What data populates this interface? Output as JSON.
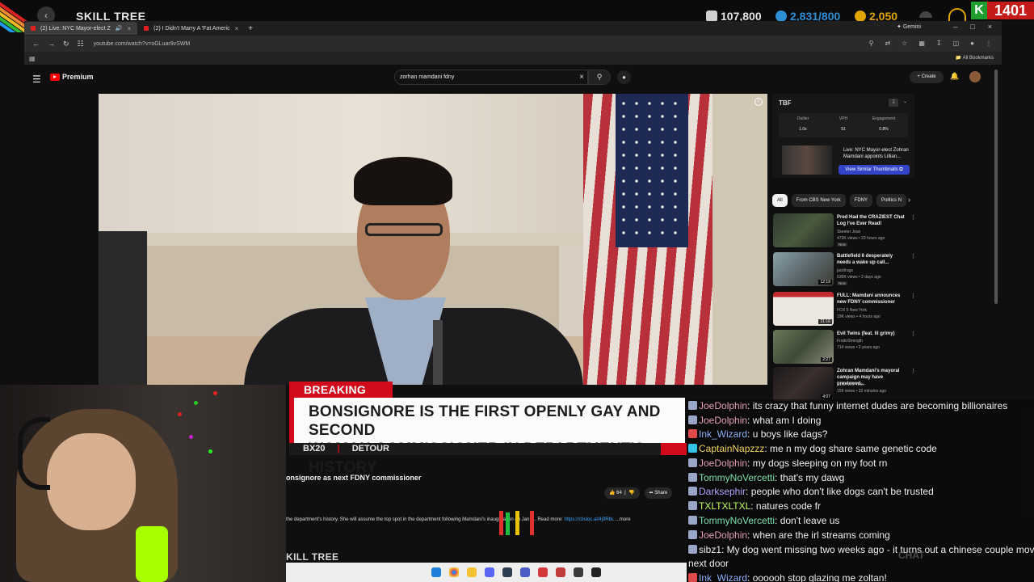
{
  "overlay": {
    "title": "SKILL TREE",
    "stats": [
      {
        "value": "107,800",
        "color": "#e6e6e6",
        "icon": "fist-icon"
      },
      {
        "value": "2,831/800",
        "color": "#2f8fd6",
        "icon": "shield-icon"
      },
      {
        "value": "2,050",
        "color": "#e0a400",
        "icon": "coin-icon"
      }
    ],
    "k_badge": "K",
    "counter": "1401"
  },
  "browser": {
    "tabs": [
      {
        "label": "(2) Live: NYC Mayor-elect Z"
      },
      {
        "label": "(2) I Didn't Marry A 'Fat Americ"
      }
    ],
    "gemini": "Gemini",
    "url": "youtube.com/watch?v=oGLuar9vSWM",
    "all_bookmarks": "All Bookmarks"
  },
  "youtube": {
    "premium_label": "Premium",
    "search_value": "zorhan mamdani fdny",
    "create_label": "Create",
    "video": {
      "breaking_tag": "BREAKING NEWS",
      "headline_line1": "BONSIGNORE IS THE FIRST OPENLY GAY AND SECOND",
      "headline_line2": "WOMAN COMMISSIONER IN DEPARTMENT'S HISTORY",
      "sub_left": "BX20",
      "sub_right": "DETOUR"
    },
    "title_fragment": "onsignore as next FDNY commissioner",
    "like_count": "64",
    "share_label": "Share",
    "desc_text": "the department's history. She will assume the top spot in the department following Mamdani's inauguration on Jan. 1. Read more:",
    "desc_link": "https://cbsloc.al/4j9RbL",
    "desc_more": "...more",
    "bottom_brand": "KILL TREE"
  },
  "extension": {
    "logo": "TBF",
    "stats": [
      {
        "label": "Outlier",
        "value": "1.0x"
      },
      {
        "label": "VPH",
        "value": "51"
      },
      {
        "label": "Engagement",
        "value": "0.8%"
      }
    ],
    "current_title": "Live: NYC Mayor-elect Zohran Mamdani appoints Lillian...",
    "similar_button": "View Similar Thumbnails"
  },
  "chips": [
    "All",
    "From CBS New York",
    "FDNY",
    "Politics N"
  ],
  "recommendations": [
    {
      "title": "Pred Had the CRAZIEST Chat Log I've Ever Read!",
      "channel": "Skeeter Jean",
      "meta": "473K views • 23 hours ago",
      "badge": "New",
      "duration": "",
      "thumb": "#3a4a3e"
    },
    {
      "title": "Battlefield 6 desperately needs a wake up call...",
      "channel": "jackfrags",
      "meta": "636K views • 2 days ago",
      "badge": "New",
      "duration": "12:19",
      "thumb": "#5d6a6f"
    },
    {
      "title": "FULL: Mamdani announces new FDNY commissioner",
      "channel": "FOX 5 New York",
      "meta": "19K views • 4 hours ago",
      "badge": "",
      "duration": "21:16",
      "thumb": "#6b2a2e"
    },
    {
      "title": "Evil Twins (feat. lil grimy)",
      "channel": "FredoStrength",
      "meta": "714 views • 2 years ago",
      "badge": "",
      "duration": "2:27",
      "thumb": "#4a5a3e"
    },
    {
      "title": "Zohran Mamdani's mayoral campaign may have previewed...",
      "channel": "CBS New York",
      "meta": "159 views • 33 minutes ago",
      "badge": "New",
      "duration": "4:07",
      "thumb": "#2e2a2a"
    }
  ],
  "chat": [
    {
      "user": "JoeDolphin",
      "color": "#e8a0b8",
      "text": ": its crazy that funny internet dudes are becoming billionaires",
      "badge": "#9aa6c8"
    },
    {
      "user": "JoeDolphin",
      "color": "#e8a0b8",
      "text": ": what am I doing",
      "badge": "#9aa6c8"
    },
    {
      "user": "Ink_Wizard",
      "color": "#8fb3ff",
      "text": ": u boys like dags?",
      "badge": "#e04a4a"
    },
    {
      "user": "CaptainNapzzz",
      "color": "#f4d35e",
      "text": ": me n my dog share same genetic code",
      "badge": "#34c3e8"
    },
    {
      "user": "JoeDolphin",
      "color": "#e8a0b8",
      "text": ": my dogs sleeping on my foot rn",
      "badge": "#9aa6c8"
    },
    {
      "user": "TommyNoVercetti",
      "color": "#7fe3b0",
      "text": ": that's my dawg",
      "badge": "#9aa6c8"
    },
    {
      "user": "Darksephir",
      "color": "#b9a4ff",
      "text": ": people who don't like dogs can't be trusted",
      "badge": "#9aa6c8"
    },
    {
      "user": "TXLTXLTXL",
      "color": "#c3ff5c",
      "text": ": natures code fr",
      "badge": "#9aa6c8"
    },
    {
      "user": "TommyNoVercetti",
      "color": "#7fe3b0",
      "text": ": don't leave us",
      "badge": "#9aa6c8"
    },
    {
      "user": "JoeDolphin",
      "color": "#e8a0b8",
      "text": ": when are the irl streams coming",
      "badge": "#9aa6c8"
    },
    {
      "user": "sibz1",
      "color": "#f0f0f0",
      "text": ": My dog went missing two weeks ago - it turns out a chinese couple moved",
      "badge": "#9aa6c8"
    },
    {
      "user": "",
      "color": "#f0f0f0",
      "text": "next door",
      "badge": ""
    },
    {
      "user": "Ink_Wizard",
      "color": "#8fb3ff",
      "text": ": oooooh stop glazing me zoltan!",
      "badge": "#e04a4a"
    }
  ],
  "chat_watermark": "CHAT"
}
